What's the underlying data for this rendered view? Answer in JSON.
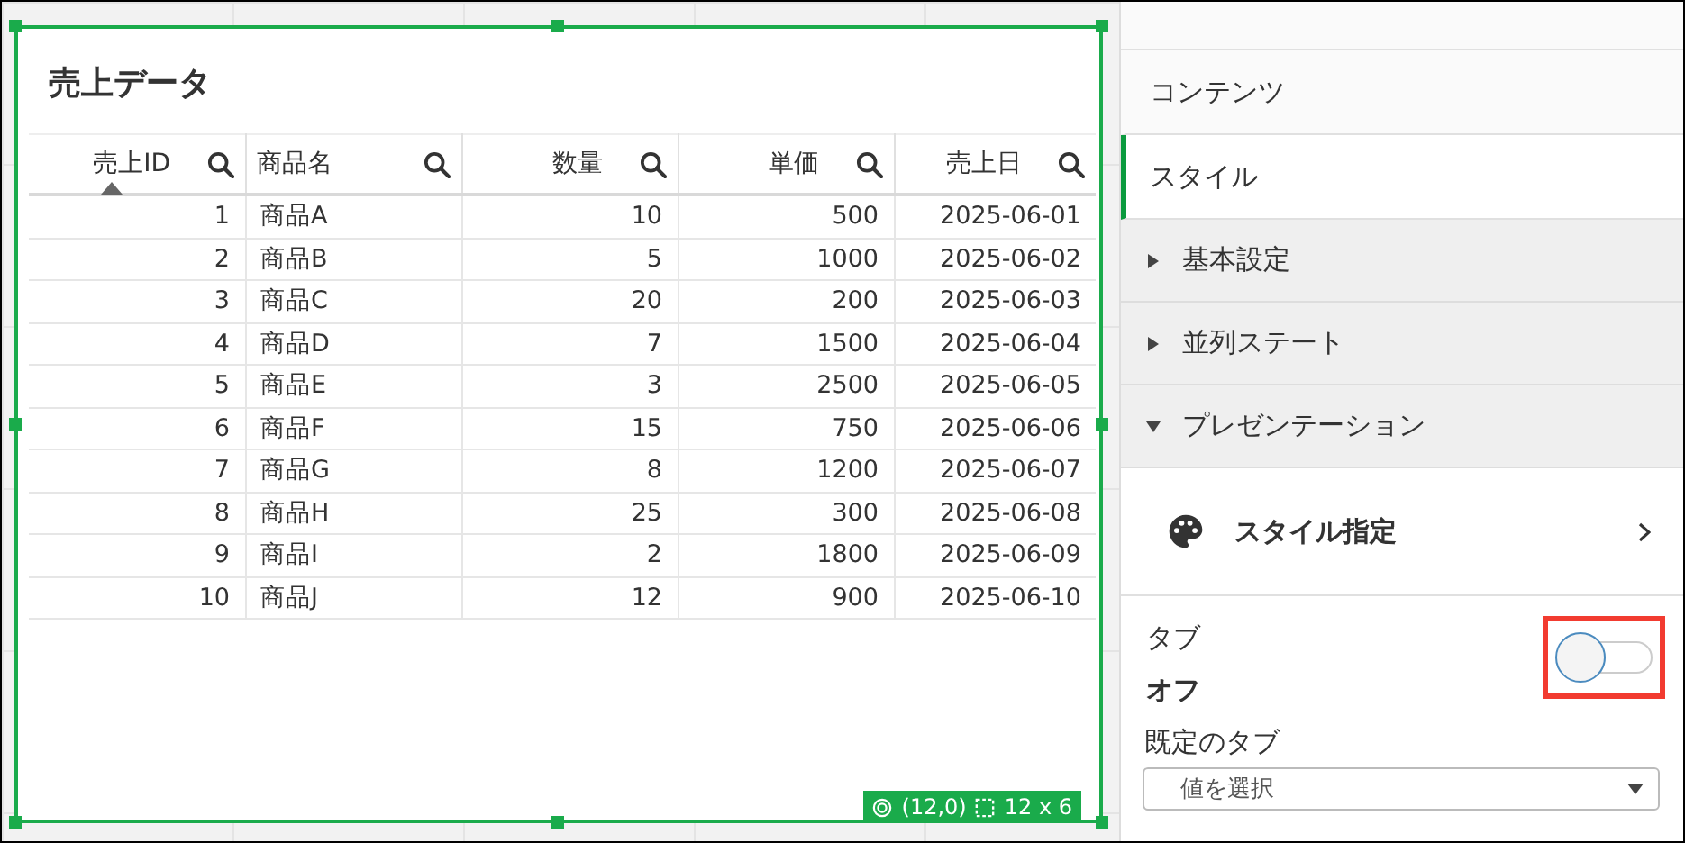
{
  "card": {
    "title": "売上データ",
    "columns": [
      {
        "label": "売上ID",
        "kind": "number",
        "sorted": true
      },
      {
        "label": "商品名",
        "kind": "text",
        "sorted": false
      },
      {
        "label": "数量",
        "kind": "number",
        "sorted": false
      },
      {
        "label": "単価",
        "kind": "number",
        "sorted": false
      },
      {
        "label": "売上日",
        "kind": "number",
        "sorted": false
      }
    ],
    "rows": [
      [
        "1",
        "商品A",
        "10",
        "500",
        "2025-06-01"
      ],
      [
        "2",
        "商品B",
        "5",
        "1000",
        "2025-06-02"
      ],
      [
        "3",
        "商品C",
        "20",
        "200",
        "2025-06-03"
      ],
      [
        "4",
        "商品D",
        "7",
        "1500",
        "2025-06-04"
      ],
      [
        "5",
        "商品E",
        "3",
        "2500",
        "2025-06-05"
      ],
      [
        "6",
        "商品F",
        "15",
        "750",
        "2025-06-06"
      ],
      [
        "7",
        "商品G",
        "8",
        "1200",
        "2025-06-07"
      ],
      [
        "8",
        "商品H",
        "25",
        "300",
        "2025-06-08"
      ],
      [
        "9",
        "商品I",
        "2",
        "1800",
        "2025-06-09"
      ],
      [
        "10",
        "商品J",
        "12",
        "900",
        "2025-06-10"
      ]
    ],
    "badge": {
      "position": "(12,0)",
      "size": "12 x 6"
    }
  },
  "panel": {
    "tabs": [
      {
        "label": "コンテンツ",
        "selected": false
      },
      {
        "label": "スタイル",
        "selected": true
      }
    ],
    "sections": [
      {
        "label": "基本設定",
        "expanded": false
      },
      {
        "label": "並列ステート",
        "expanded": false
      },
      {
        "label": "プレゼンテーション",
        "expanded": true
      }
    ],
    "style_link": {
      "label": "スタイル指定"
    },
    "toggle": {
      "label": "タブ",
      "on": false,
      "state_text": "オフ",
      "highlighted": true
    },
    "default_tab": {
      "label": "既定のタブ",
      "placeholder": "値を選択"
    }
  }
}
